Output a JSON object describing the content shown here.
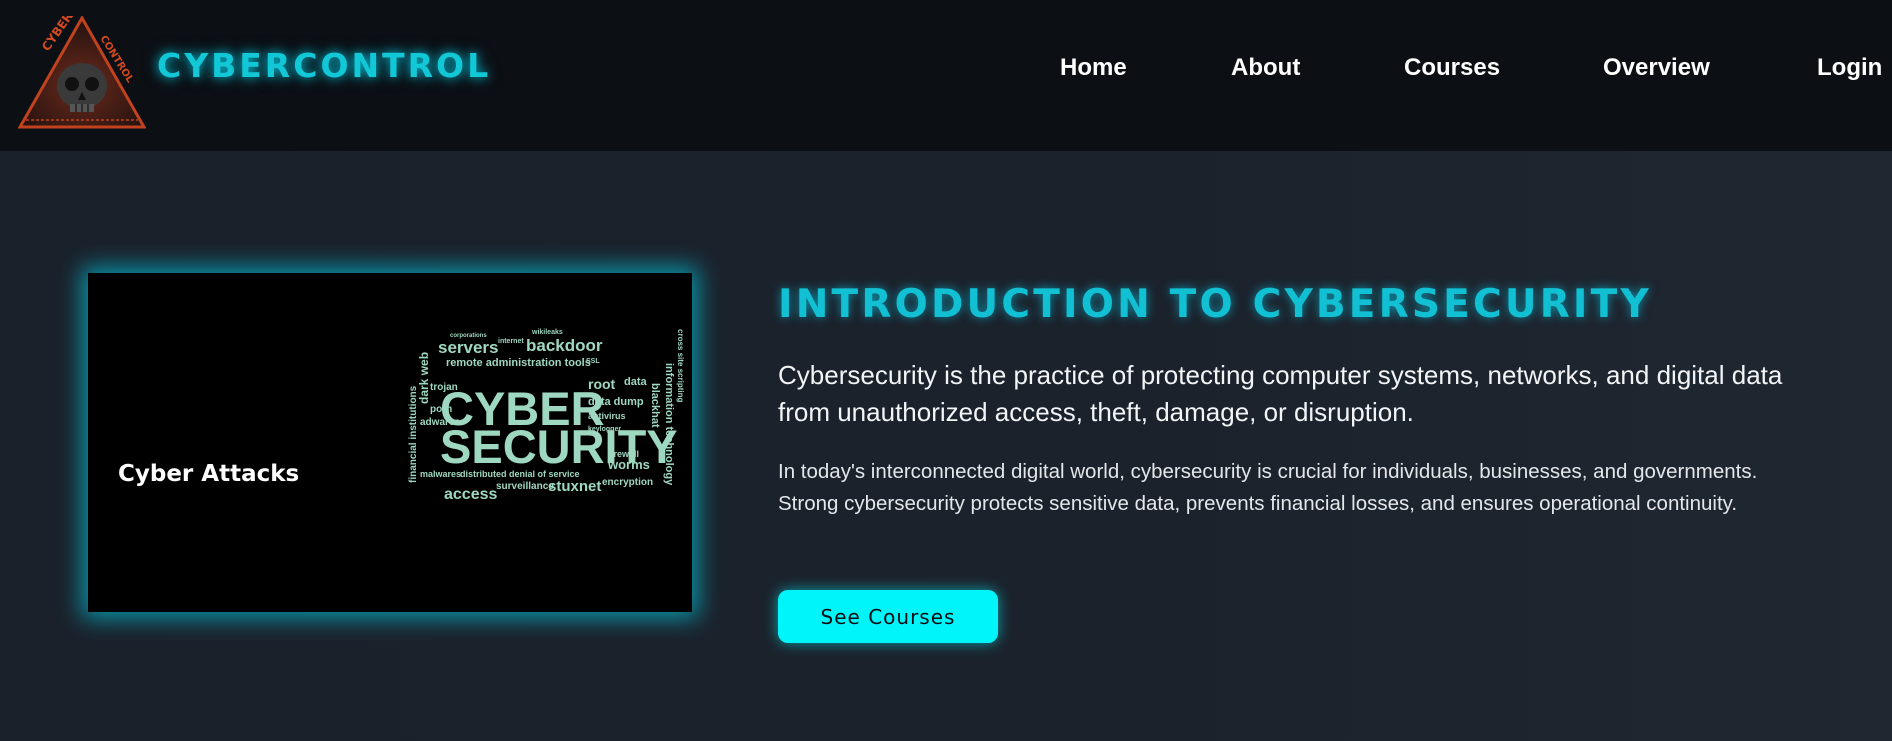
{
  "header": {
    "brand": "CYBERCONTROL",
    "logo_icon": "skull-triangle-logo",
    "logo_text_top": "CYBER",
    "logo_text_right": "CONTROL",
    "nav": [
      {
        "label": "Home"
      },
      {
        "label": "About"
      },
      {
        "label": "Courses"
      },
      {
        "label": "Overview"
      },
      {
        "label": "Login"
      }
    ]
  },
  "hero": {
    "image_caption": "Cyber Attacks",
    "wordcloud": {
      "main": [
        "CYBER",
        "SECURITY"
      ],
      "words": [
        "dark web",
        "servers",
        "backdoor",
        "remote administration tools",
        "root",
        "data",
        "data dump",
        "trojan",
        "porn",
        "adwares",
        "antivirus",
        "blackhat",
        "information technology",
        "cross site scripting",
        "financial institutions",
        "malwares",
        "distributed denial of service",
        "surveillance",
        "stuxnet",
        "access",
        "worms",
        "firewall",
        "encryption",
        "internet",
        "wikileaks",
        "corporations",
        "SSL",
        "keylogger"
      ]
    },
    "title": "INTRODUCTION TO CYBERSECURITY",
    "lead": "Cybersecurity is the practice of protecting computer systems, networks, and digital data from unauthorized access, theft, damage, or disruption.",
    "body": "In today's interconnected digital world, cybersecurity is crucial for individuals, businesses, and governments. Strong cybersecurity protects sensitive data, prevents financial losses, and ensures operational continuity.",
    "cta_label": "See Courses"
  },
  "colors": {
    "accent": "#12c7d6",
    "button": "#00f5fb",
    "navbar": "#0c0f14",
    "background": "#1a212b",
    "logo": "#c0421e"
  }
}
